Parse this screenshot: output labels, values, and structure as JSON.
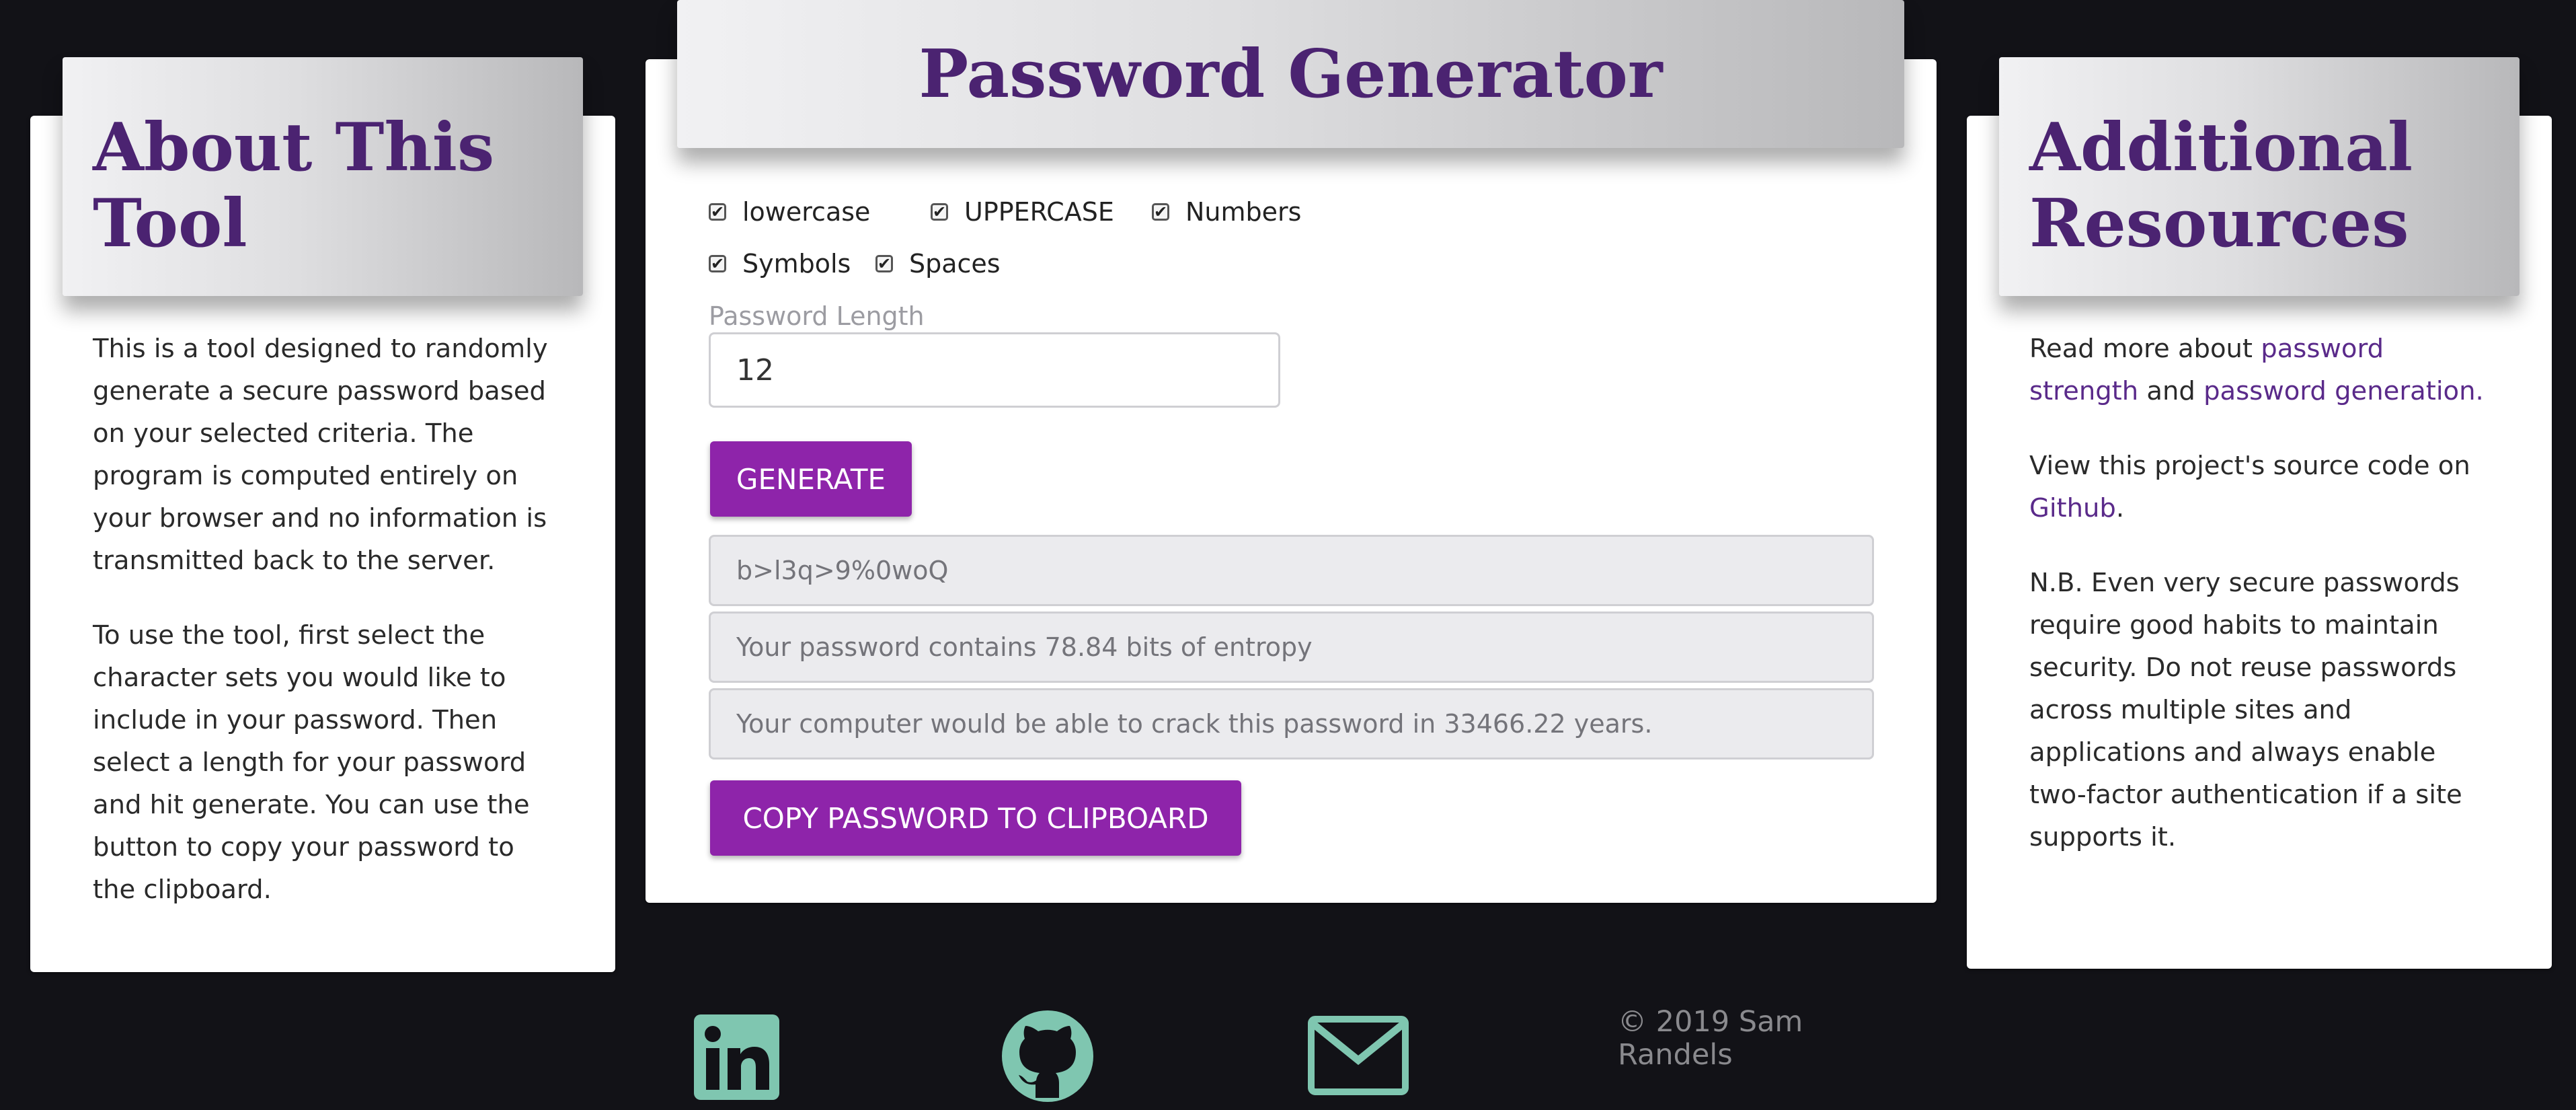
{
  "colors": {
    "background": "#121217",
    "accent": "#8e24aa",
    "title": "#4b2371",
    "link": "#5a2a8a",
    "footer_icon": "#7fc6b0"
  },
  "about": {
    "title": "About This Tool",
    "paragraphs": [
      "This is a tool designed to randomly generate a secure password based on your selected criteria. The program is computed entirely on your browser and no information is transmitted back to the server.",
      "To use the tool, first select the character sets you would like to include in your password. Then select a length for your password and hit generate. You can use the button to copy your password to the clipboard."
    ]
  },
  "generator": {
    "title": "Password Generator",
    "checkboxes": [
      {
        "label": "lowercase",
        "checked": true
      },
      {
        "label": "UPPERCASE",
        "checked": true
      },
      {
        "label": "Numbers",
        "checked": true
      },
      {
        "label": "Symbols",
        "checked": true
      },
      {
        "label": "Spaces",
        "checked": true
      }
    ],
    "length_label": "Password Length",
    "length_value": "12",
    "generate_label": "GENERATE",
    "password": "b>l3q>9%0woQ",
    "entropy_text": "Your password contains 78.84 bits of entropy",
    "crack_text": "Your computer would be able to crack this password in 33466.22 years.",
    "copy_label": "COPY PASSWORD TO CLIPBOARD"
  },
  "resources": {
    "title": "Additional Resources",
    "p1_before": "Read more about ",
    "p1_link1": "password strength",
    "p1_mid": " and ",
    "p1_link2": "password generation.",
    "p2_before": "View this project's source code on ",
    "p2_link": "Github",
    "p2_after": ".",
    "p3": "N.B. Even very secure passwords require good habits to maintain security. Do not reuse passwords across multiple sites and applications and always enable two-factor authentication if a site supports it."
  },
  "footer": {
    "icons": [
      "linkedin-icon",
      "github-icon",
      "mail-icon"
    ],
    "copyright": "© 2019 Sam Randels"
  }
}
